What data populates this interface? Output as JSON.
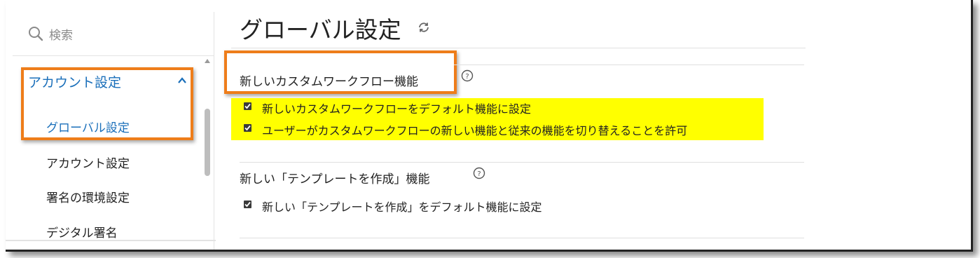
{
  "sidebar": {
    "search_label": "検索",
    "section_label": "アカウント設定",
    "items": [
      {
        "label": "グローバル設定",
        "active": true
      },
      {
        "label": "アカウント設定",
        "active": false
      },
      {
        "label": "署名の環境設定",
        "active": false
      },
      {
        "label": "デジタル署名",
        "active": false
      }
    ]
  },
  "main": {
    "title": "グローバル設定",
    "sections": [
      {
        "title": "新しいカスタムワークフロー機能",
        "options": [
          {
            "label": "新しいカスタムワークフローをデフォルト機能に設定",
            "checked": true
          },
          {
            "label": "ユーザーがカスタムワークフローの新しい機能と従来の機能を切り替えることを許可",
            "checked": true
          }
        ]
      },
      {
        "title": "新しい「テンプレートを作成」機能",
        "options": [
          {
            "label": "新しい「テンプレートを作成」をデフォルト機能に設定",
            "checked": true
          }
        ]
      }
    ]
  },
  "colors": {
    "accent": "#1a6fba",
    "annotation": "#ee7d1a",
    "highlight": "#ffff00"
  }
}
